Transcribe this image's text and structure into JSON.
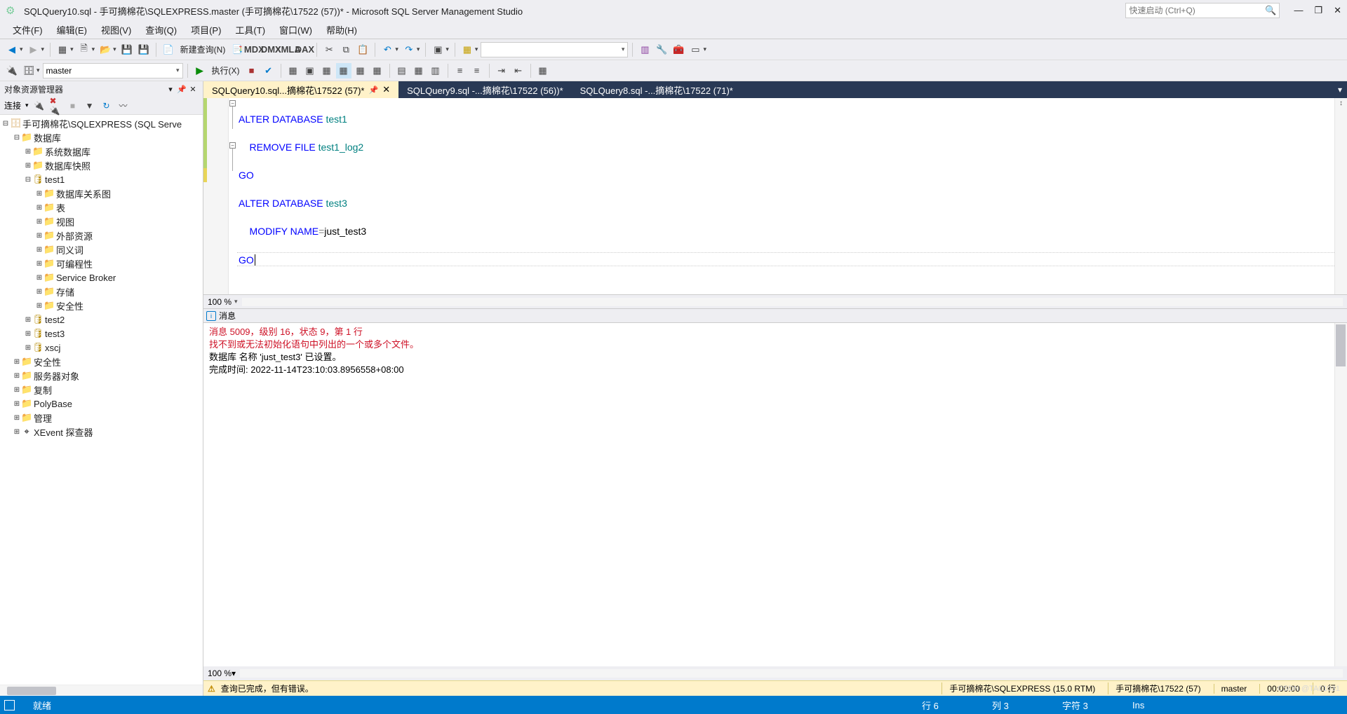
{
  "title": "SQLQuery10.sql - 手可摘棉花\\SQLEXPRESS.master (手可摘棉花\\17522 (57))* - Microsoft SQL Server Management Studio",
  "quick_launch_placeholder": "快速启动 (Ctrl+Q)",
  "menu": [
    "文件(F)",
    "编辑(E)",
    "视图(V)",
    "查询(Q)",
    "项目(P)",
    "工具(T)",
    "窗口(W)",
    "帮助(H)"
  ],
  "toolbar1": {
    "new_query": "新建查询(N)"
  },
  "toolbar2": {
    "db_combo": "master",
    "execute": "执行(X)"
  },
  "object_explorer": {
    "title": "对象资源管理器",
    "connect_label": "连接",
    "server": "手可摘棉花\\SQLEXPRESS (SQL Serve",
    "databases_label": "数据库",
    "nodes_l2": [
      "系统数据库",
      "数据库快照"
    ],
    "test1": "test1",
    "test1_children": [
      "数据库关系图",
      "表",
      "视图",
      "外部资源",
      "同义词",
      "可编程性",
      "Service Broker",
      "存储",
      "安全性"
    ],
    "dbs_after": [
      "test2",
      "test3",
      "xscj"
    ],
    "root_rest": [
      "安全性",
      "服务器对象",
      "复制",
      "PolyBase",
      "管理",
      "XEvent 探查器"
    ]
  },
  "tabs": [
    {
      "label": "SQLQuery10.sql...摘棉花\\17522 (57)*",
      "active": true
    },
    {
      "label": "SQLQuery9.sql -...摘棉花\\17522 (56))*",
      "active": false
    },
    {
      "label": "SQLQuery8.sql -...摘棉花\\17522 (71)*",
      "active": false
    }
  ],
  "code": {
    "l1a": "ALTER",
    "l1b": " DATABASE",
    "l1c": " test1",
    "l2a": "    REMOVE",
    "l2b": " FILE",
    "l2c": " test1_log2",
    "l3": "GO",
    "l4a": "ALTER",
    "l4b": " DATABASE",
    "l4c": " test3",
    "l5a": "    MODIFY",
    "l5b": " NAME",
    "l5eq": "=",
    "l5c": "just_test3",
    "l6": "GO"
  },
  "zoom1": "100 %",
  "msg_tab": "消息",
  "messages": {
    "l1": "消息 5009，级别 16，状态 9，第 1 行",
    "l2": "找不到或无法初始化语句中列出的一个或多个文件。",
    "l3": "数据库 名称 'just_test3' 已设置。",
    "l4": "",
    "l5": "完成时间: 2022-11-14T23:10:03.8956558+08:00"
  },
  "zoom2": "100 %",
  "query_status": {
    "text": "查询已完成，但有错误。",
    "server": "手可摘棉花\\SQLEXPRESS (15.0 RTM)",
    "user": "手可摘棉花\\17522 (57)",
    "db": "master",
    "time": "00:00:00",
    "rows": "0 行"
  },
  "statusbar": {
    "ready": "就绪",
    "line": "行 6",
    "col": "列 3",
    "char": "字符 3",
    "ins": "Ins"
  },
  "watermark": "CSDN @TA01031"
}
